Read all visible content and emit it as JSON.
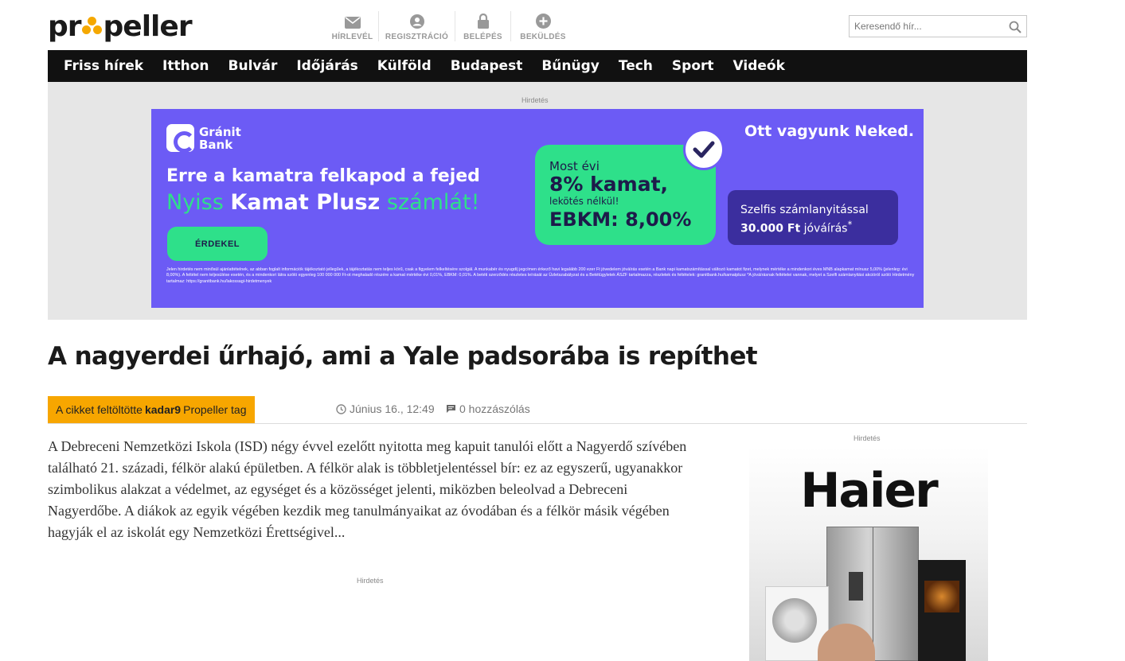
{
  "header": {
    "logo_text_left": "pr",
    "logo_text_right": "peller",
    "top_links": [
      {
        "label": "HÍRLEVÉL",
        "icon": "mail-icon"
      },
      {
        "label": "REGISZTRÁCIÓ",
        "icon": "user-icon"
      },
      {
        "label": "BELÉPÉS",
        "icon": "lock-icon"
      },
      {
        "label": "BEKÜLDÉS",
        "icon": "plus-icon"
      }
    ],
    "search_placeholder": "Keresendő hír..."
  },
  "nav": {
    "items": [
      "Friss hírek",
      "Itthon",
      "Bulvár",
      "Időjárás",
      "Külföld",
      "Budapest",
      "Bűnügy",
      "Tech",
      "Sport",
      "Videók"
    ]
  },
  "ad_top": {
    "label": "Hirdetés",
    "bank_name_1": "Gránit",
    "bank_name_2": "Bank",
    "headline": "Erre a kamatra felkapod a fejed",
    "sub_1": "Nyiss ",
    "sub_2": "Kamat Plusz",
    "sub_3": " számlát!",
    "button": "ÉRDEKEL",
    "box_l1": "Most évi",
    "box_l2": "8% kamat,",
    "box_l3": "lekötés nélkül!",
    "box_l4": "EBKM: 8,00%",
    "right_title": "Ott vagyunk Neked.",
    "dark_l1": "Szelfis számlanyitással",
    "dark_l2": "30.000 Ft",
    "dark_l3": " jóváírás",
    "dark_sup": "*",
    "fine_print": "Jelen hirdetés nem minősül ajánlattételnek, az abban foglalt információk tájékoztató jellegűek, a tájékoztatás nem teljes körű, csak a figyelem felkeltésére szolgál. A munkabér és nyugdíj jegcímen érkező havi legalább 200 ezer Ft jövedelem jóváírás esetén a Bank napi kamatszámítással változó kamatot fizet, melynek mértéke a mindenkori éves MNB alapkamat mínusz 5,00% (jelenleg: évi 8,00%). A feltétel nem teljesülése esetén, és a mindenkori látra szóló egyenleg 100 000 000 Ft-ot meghaladó részére a kamat mértéke évi 0,01%, EBKM: 0,01%. A betéti szerződés részletes leírását az Üzletszabályzat és a Betétügyletek ÁSZF tartalmazza, részletek és feltételek: granitbank.hu/kamatplusz *A jóváírásnak feltételei vannak, melyet a Szelfi számlanyitási akcióról szóló Hirdetmény tartalmaz: https://granitbank.hu/lakossagi-hirdetmenyek"
  },
  "article": {
    "title": "A nagyerdei űrhajó, ami a Yale padsorába is repíthet",
    "uploader_prefix": "A cikket feltöltötte",
    "uploader_name": "kadar9",
    "uploader_suffix": "Propeller tag",
    "date": "Június 16., 12:49",
    "comments": "0 hozzászólás",
    "lead": "A Debreceni Nemzetközi Iskola (ISD) négy évvel ezelőtt nyitotta meg kapuit tanulói előtt a Nagyerdő szívében található 21. századi, félkör alakú épületben. A félkör alak is többletjelentéssel bír: ez az egyszerű, ugyanakkor szimbolikus alakzat a védelmet, az egységet és a közösséget jelenti, miközben beleolvad a Debreceni Nagyerdőbe. A diákok az egyik végében kezdik meg tanulmányaikat az óvodában és a félkör másik végében hagyják el az iskolát egy Nemzetközi Érettségivel...",
    "inline_ad_label": "Hirdetés"
  },
  "sidebar": {
    "ad_label": "Hirdetés",
    "ad_brand": "Haier"
  },
  "colors": {
    "nav_bg": "#111111",
    "uploader_bg": "#f7a600",
    "banner_bg": "#6c5bf5",
    "banner_green": "#2ee08a",
    "banner_dark": "#3b2e9e"
  }
}
